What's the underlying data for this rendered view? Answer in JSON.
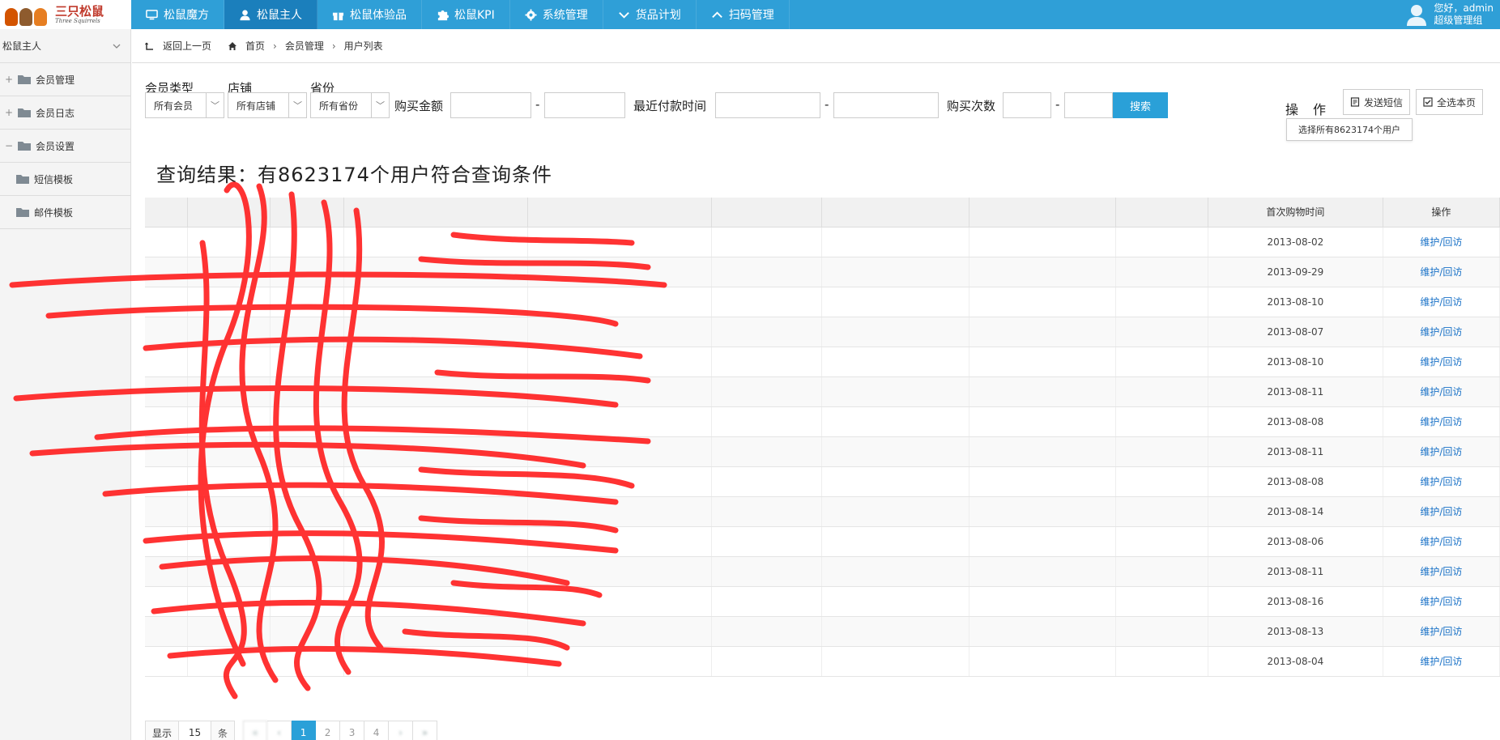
{
  "logo": {
    "text": "三只松鼠",
    "sub": "Three Squirrels"
  },
  "nav": [
    {
      "label": "松鼠魔方",
      "icon": "monitor-icon",
      "active": false
    },
    {
      "label": "松鼠主人",
      "icon": "user-icon",
      "active": true
    },
    {
      "label": "松鼠体验品",
      "icon": "gift-icon",
      "active": false
    },
    {
      "label": "松鼠KPI",
      "icon": "puzzle-icon",
      "active": false
    },
    {
      "label": "系统管理",
      "icon": "gear-icon",
      "active": false
    },
    {
      "label": "货品计划",
      "icon": "chevron-down-icon",
      "active": false
    },
    {
      "label": "扫码管理",
      "icon": "chevron-up-icon",
      "active": false
    }
  ],
  "user": {
    "greeting": "您好，admin",
    "role": "超级管理组"
  },
  "sidebar": {
    "title": "松鼠主人",
    "items": [
      {
        "label": "会员管理",
        "toggle": "+"
      },
      {
        "label": "会员日志",
        "toggle": "+"
      },
      {
        "label": "会员设置",
        "toggle": "−"
      },
      {
        "label": "短信模板",
        "toggle": ""
      },
      {
        "label": "邮件模板",
        "toggle": ""
      }
    ]
  },
  "breadcrumb": {
    "back": "返回上一页",
    "home": "首页",
    "section": "会员管理",
    "current": "用户列表"
  },
  "filters": {
    "member_type_label": "会员类型",
    "member_type_value": "所有会员",
    "store_label": "店铺",
    "store_value": "所有店铺",
    "province_label": "省份",
    "province_value": "所有省份",
    "amount_label": "购买金额",
    "last_pay_label": "最近付款时间",
    "count_label": "购买次数",
    "dash": "-",
    "search_button": "搜索"
  },
  "operations": {
    "label": "操作",
    "send_sms": "发送短信",
    "select_page": "全选本页",
    "tooltip": "选择所有8623174个用户"
  },
  "result_text": "查询结果：有8623174个用户符合查询条件",
  "table": {
    "headers": [
      "",
      "",
      "",
      "",
      "",
      "",
      "",
      "",
      "",
      "首次购物时间",
      "操作"
    ],
    "action_label": "维护/回访",
    "first_purchase": [
      "2013-08-02",
      "2013-09-29",
      "2013-08-10",
      "2013-08-07",
      "2013-08-10",
      "2013-08-11",
      "2013-08-08",
      "2013-08-11",
      "2013-08-08",
      "2013-08-14",
      "2013-08-06",
      "2013-08-11",
      "2013-08-16",
      "2013-08-13",
      "2013-08-04"
    ]
  },
  "pager": {
    "show": "显示",
    "size": "15",
    "unit": "条",
    "current": "1",
    "pages": [
      "2",
      "3",
      "4"
    ]
  }
}
